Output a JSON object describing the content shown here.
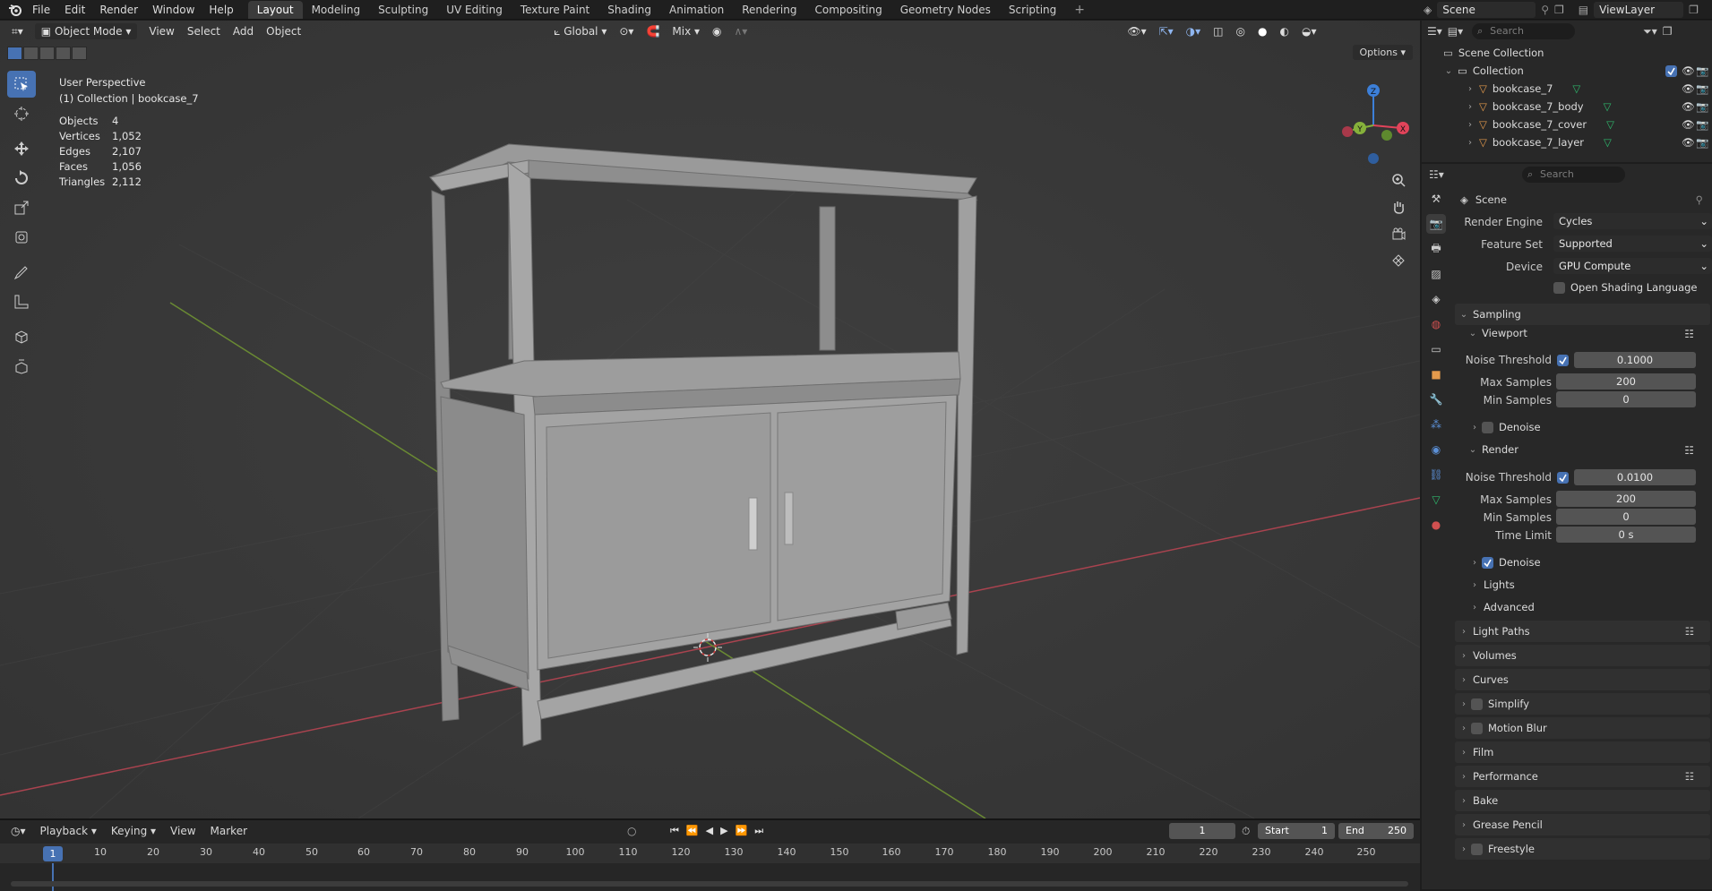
{
  "menu": [
    "File",
    "Edit",
    "Render",
    "Window",
    "Help"
  ],
  "workspaces": [
    "Layout",
    "Modeling",
    "Sculpting",
    "UV Editing",
    "Texture Paint",
    "Shading",
    "Animation",
    "Rendering",
    "Compositing",
    "Geometry Nodes",
    "Scripting"
  ],
  "active_workspace": "Layout",
  "scene_name": "Scene",
  "view_layer": "ViewLayer",
  "viewport": {
    "mode": "Object Mode",
    "menus": [
      "View",
      "Select",
      "Add",
      "Object"
    ],
    "orientation": "Global",
    "snap_mode": "Mix",
    "options_label": "Options",
    "title": "User Perspective",
    "context": "(1) Collection | bookcase_7",
    "stats": [
      {
        "k": "Objects",
        "v": "4"
      },
      {
        "k": "Vertices",
        "v": "1,052"
      },
      {
        "k": "Edges",
        "v": "2,107"
      },
      {
        "k": "Faces",
        "v": "1,056"
      },
      {
        "k": "Triangles",
        "v": "2,112"
      }
    ],
    "gizmo": {
      "x": "X",
      "y": "Y",
      "z": "Z"
    }
  },
  "timeline": {
    "menus": [
      "Playback",
      "Keying",
      "View",
      "Marker"
    ],
    "current_frame": "1",
    "start_label": "Start",
    "start": "1",
    "end_label": "End",
    "end": "250",
    "ticks": [
      "10",
      "20",
      "30",
      "40",
      "50",
      "60",
      "70",
      "80",
      "90",
      "100",
      "110",
      "120",
      "130",
      "140",
      "150",
      "160",
      "170",
      "180",
      "190",
      "200",
      "210",
      "220",
      "230",
      "240",
      "250"
    ]
  },
  "outliner": {
    "search_placeholder": "Search",
    "scene_collection": "Scene Collection",
    "collection": "Collection",
    "objects": [
      "bookcase_7",
      "bookcase_7_body",
      "bookcase_7_cover",
      "bookcase_7_layer"
    ]
  },
  "properties": {
    "search_placeholder": "Search",
    "context": "Scene",
    "render_engine_label": "Render Engine",
    "render_engine": "Cycles",
    "feature_set_label": "Feature Set",
    "feature_set": "Supported",
    "device_label": "Device",
    "device": "GPU Compute",
    "osl_label": "Open Shading Language",
    "sampling": "Sampling",
    "viewport_sub": "Viewport",
    "noise_threshold_label": "Noise Threshold",
    "vp_noise_threshold": "0.1000",
    "max_samples_label": "Max Samples",
    "vp_max_samples": "200",
    "min_samples_label": "Min Samples",
    "vp_min_samples": "0",
    "denoise_label": "Denoise",
    "render_sub": "Render",
    "r_noise_threshold": "0.0100",
    "r_max_samples": "200",
    "r_min_samples": "0",
    "time_limit_label": "Time Limit",
    "r_time_limit": "0 s",
    "lights": "Lights",
    "advanced": "Advanced",
    "sections": [
      "Light Paths",
      "Volumes",
      "Curves",
      "Simplify",
      "Motion Blur",
      "Film",
      "Performance",
      "Bake",
      "Grease Pencil",
      "Freestyle"
    ]
  },
  "colors": {
    "accent": "#4772b3",
    "x_axis": "#e1435a",
    "y_axis": "#86b13b",
    "z_axis": "#3c7fd8"
  }
}
